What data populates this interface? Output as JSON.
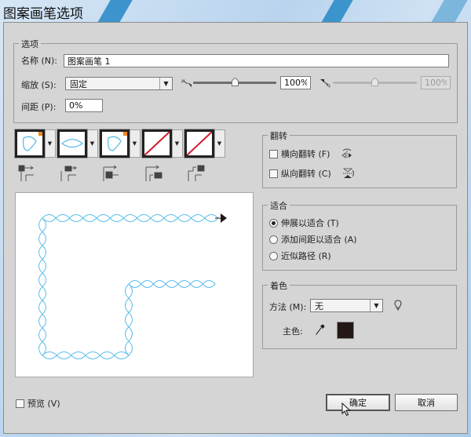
{
  "window": {
    "title": "图案画笔选项"
  },
  "options": {
    "legend": "选项",
    "name_label": "名称 (N):",
    "name_value": "图案画笔 1",
    "scale_label": "缩放 (S):",
    "scale_value": "固定",
    "scale_min_percent": "100%",
    "scale_min_slider_value": 0.5,
    "scale_max_percent": "100%",
    "scale_max_slider_value": 0.5,
    "spacing_label": "间距 (P):",
    "spacing_value": "0%"
  },
  "tiles": [
    {
      "name": "side-tile",
      "icon": "petal-shape-icon",
      "has_corner": true,
      "corner_color": "#f08a18",
      "selector_icon": "side-tile-selector-icon"
    },
    {
      "name": "outer-corner-tile",
      "icon": "ellipse-shape-icon",
      "has_corner": false,
      "selector_icon": "outer-corner-tile-selector-icon"
    },
    {
      "name": "inner-corner-tile",
      "icon": "petal-shape-icon",
      "has_corner": true,
      "corner_color": "#f08a18",
      "selector_icon": "inner-corner-tile-selector-icon"
    },
    {
      "name": "start-tile",
      "icon": "none-slash-icon",
      "has_corner": false,
      "selector_icon": "start-tile-selector-icon"
    },
    {
      "name": "end-tile",
      "icon": "none-slash-icon",
      "has_corner": false,
      "selector_icon": "end-tile-selector-icon"
    }
  ],
  "flip": {
    "legend": "翻转",
    "horizontal_label": "横向翻转 (F)",
    "horizontal_checked": false,
    "vertical_label": "纵向翻转 (C)",
    "vertical_checked": false
  },
  "fit": {
    "legend": "适合",
    "options": [
      {
        "label": "伸展以适合 (T)",
        "selected": true
      },
      {
        "label": "添加间距以适合 (A)",
        "selected": false
      },
      {
        "label": "近似路径 (R)",
        "selected": false
      }
    ]
  },
  "colorization": {
    "legend": "着色",
    "method_label": "方法 (M):",
    "method_value": "无",
    "key_color_label": "主色:",
    "key_color": "#231815",
    "tips_icon": "lightbulb-icon",
    "eyedropper_icon": "eyedropper-icon"
  },
  "preview": {
    "stroke_color": "#5bbde8",
    "arrow_color": "#231815"
  },
  "footer": {
    "preview_label": "预览 (V)",
    "preview_checked": false,
    "ok_label": "确定",
    "cancel_label": "取消"
  }
}
